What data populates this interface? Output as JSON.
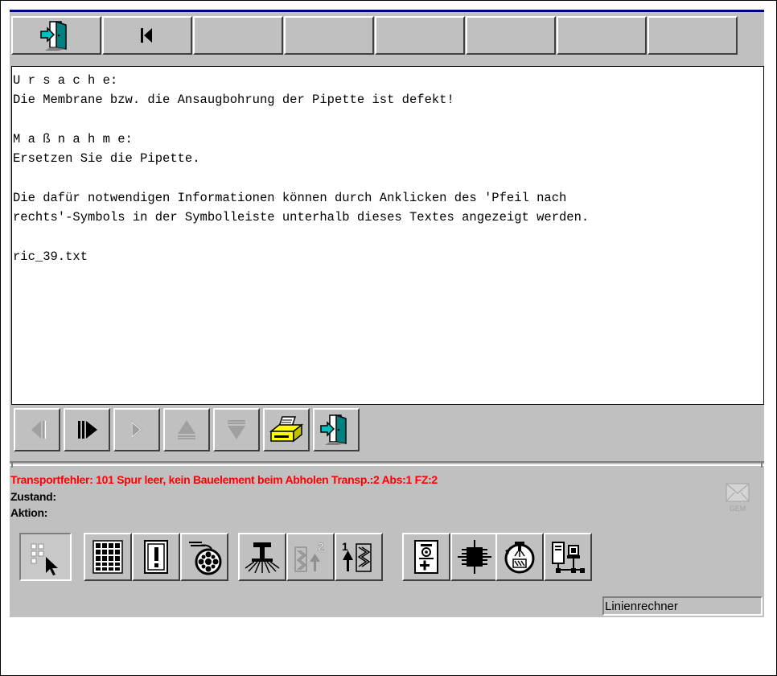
{
  "text_pane": {
    "lines": [
      "U r s a c h e:",
      "Die Membrane bzw. die Ansaugbohrung der Pipette ist defekt!",
      "",
      "M a ß n a h m e:",
      "Ersetzen Sie die Pipette.",
      "",
      "Die dafür notwendigen Informationen können durch Anklicken des 'Pfeil nach",
      "rechts'-Symbols in der Symbolleiste unterhalb dieses Textes angezeigt werden.",
      "",
      "ric_39.txt"
    ]
  },
  "messages": {
    "error": "Transportfehler: 101  Spur leer, kein Bauelement beim Abholen  Transp.:2  Abs:1  FZ:2",
    "zustand": "Zustand:",
    "aktion": "Aktion:"
  },
  "gem_icon": {
    "label": "GEM"
  },
  "statusbar": {
    "field": "Linienrechner"
  },
  "colors": {
    "error": "#ff0000",
    "face": "#c0c0c0",
    "title_line": "#000080",
    "exit_door": "#008080",
    "printer": "#ffff00"
  },
  "icons": {
    "toolbar": [
      "exit-door-icon",
      "skip-to-start-icon"
    ],
    "nav": [
      "first-disabled-icon",
      "play-icon",
      "next-disabled-icon",
      "up-disabled-icon",
      "down-disabled-icon",
      "printer-icon",
      "exit-door-icon"
    ],
    "bottom": [
      "select-cursor-icon",
      "component-list-icon",
      "exclamation-card-icon",
      "feeder-reel-icon",
      "pipette-nozzle-icon",
      "transport-2-icon",
      "transport-1-icon",
      "camera-add-icon",
      "chip-icon",
      "rotate-pipette-icon",
      "machine-line-icon"
    ]
  }
}
